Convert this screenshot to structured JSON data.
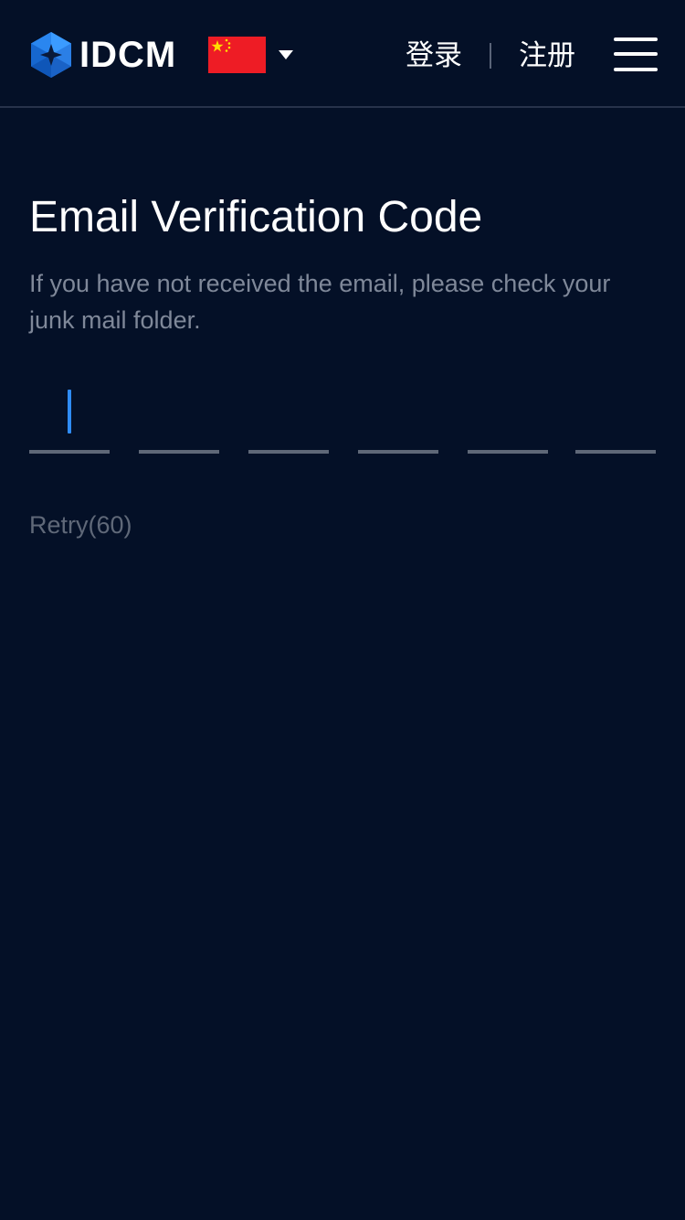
{
  "header": {
    "brand": "IDCM",
    "language_region": "China",
    "login_label": "登录",
    "register_label": "注册"
  },
  "main": {
    "title": "Email Verification Code",
    "subtitle": "If you have not received the email, please check your junk mail folder.",
    "code_digits": [
      "",
      "",
      "",
      "",
      "",
      ""
    ],
    "active_digit_index": 0,
    "retry_label": "Retry(60)"
  },
  "colors": {
    "background": "#041027",
    "accent_blue": "#2f8cf5",
    "muted_text": "#7f8899",
    "underline": "#5f6878",
    "flag_red": "#ee1c25",
    "flag_yellow": "#ffde00"
  }
}
